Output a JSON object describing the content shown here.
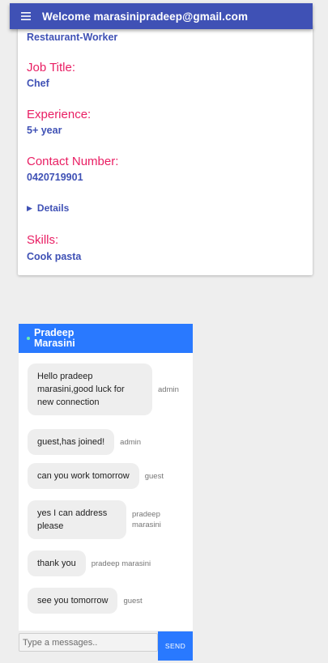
{
  "appbar": {
    "title": "Welcome marasinipradeep@gmail.com",
    "menu_icon": "hamburger-menu-icon"
  },
  "profile": {
    "category": "Restaurant-Worker",
    "job_title_label": "Job Title:",
    "job_title": "Chef",
    "experience_label": "Experience:",
    "experience": "5+ year",
    "contact_label": "Contact Number:",
    "contact": "0420719901",
    "details_label": "Details",
    "skills_label": "Skills:",
    "skills": "Cook pasta"
  },
  "colors": {
    "primary": "#3f51b5",
    "accent": "#e91e63",
    "chat_blue": "#2979ff",
    "online": "#69f0ae"
  },
  "chat": {
    "name": "Pradeep Marasini",
    "messages": [
      {
        "text": "Hello pradeep marasini,good luck for new connection",
        "author": "admin"
      },
      {
        "text": "guest,has joined!",
        "author": "admin"
      },
      {
        "text": "can you work tomorrow",
        "author": "guest"
      },
      {
        "text": "yes I can address please",
        "author": "pradeep marasini"
      },
      {
        "text": "thank you",
        "author": "pradeep marasini"
      },
      {
        "text": "see you tomorrow",
        "author": "guest"
      }
    ],
    "input_placeholder": "Type a messages..",
    "send_label": "SEND"
  }
}
